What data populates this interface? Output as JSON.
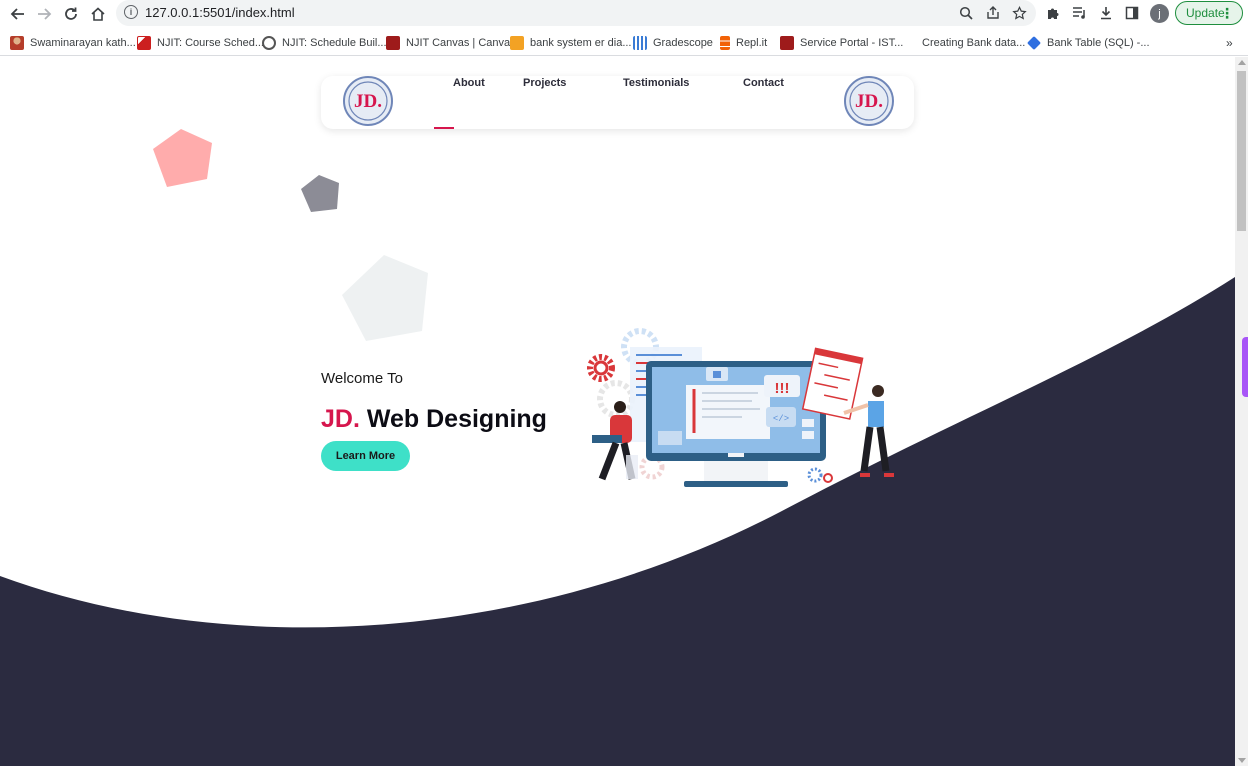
{
  "browser": {
    "url": "127.0.0.1:5501/index.html",
    "update_label": "Update",
    "avatar_initial": "j",
    "bookmarks": [
      {
        "label": "Swaminarayan kath...",
        "color": "#b53d2a"
      },
      {
        "label": "NJIT: Course Sched...",
        "color": "#cc1f1f"
      },
      {
        "label": "NJIT: Schedule Buil...",
        "color": "#555555"
      },
      {
        "label": "NJIT Canvas | Canvas",
        "color": "#9e1b1b"
      },
      {
        "label": "bank system er dia...",
        "color": "#e8850c"
      },
      {
        "label": "Gradescope",
        "color": "#3a7bd5"
      },
      {
        "label": "Repl.it",
        "color": "#f26207"
      },
      {
        "label": "Service Portal - IST...",
        "color": "#9e1b1b"
      },
      {
        "label": "Creating Bank data...",
        "color": "#ffffff"
      },
      {
        "label": "Bank Table (SQL) -...",
        "color": "#2f6fe0"
      }
    ],
    "more_label": "»"
  },
  "page": {
    "nav": {
      "links": [
        "About",
        "Projects",
        "Testimonials",
        "Contact"
      ],
      "logo_text": "JD."
    },
    "hero": {
      "welcome": "Welcome To",
      "headline_accent": "JD.",
      "headline_rest": " Web Designing",
      "cta_label": "Learn More"
    },
    "colors": {
      "accent": "#d6164d",
      "cta": "#3ee0c8",
      "navy": "#2b2b40"
    },
    "icons": {
      "back": "back-arrow-icon",
      "forward": "forward-arrow-icon",
      "reload": "reload-icon",
      "home": "home-icon",
      "info": "info-icon",
      "zoom": "zoom-icon",
      "share": "share-icon",
      "star": "star-icon",
      "extensions": "puzzle-icon",
      "media": "media-playlist-icon",
      "download": "download-icon",
      "sidepanel": "side-panel-icon",
      "menu": "three-dots-icon"
    }
  }
}
